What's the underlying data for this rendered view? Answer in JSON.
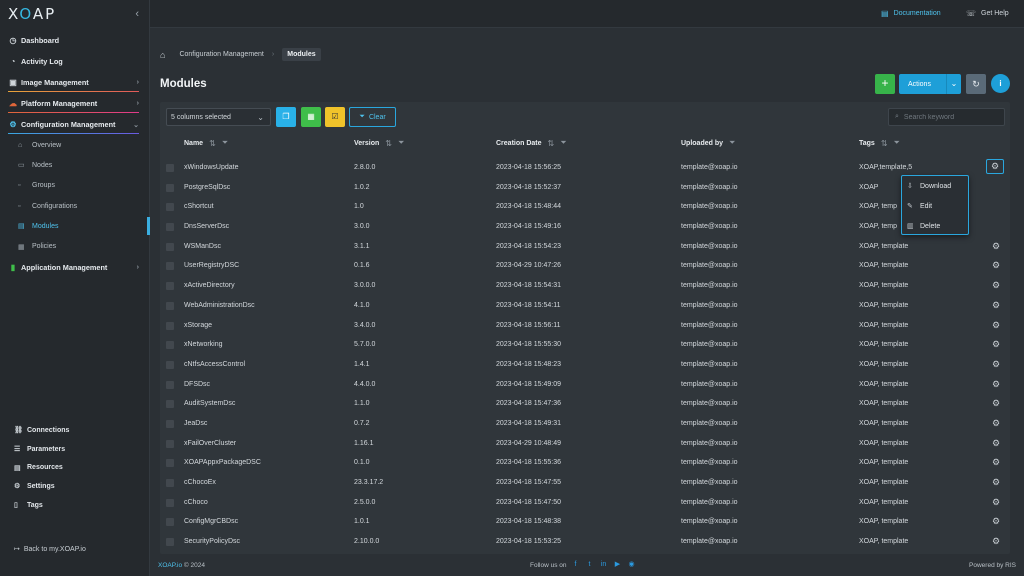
{
  "app": {
    "logo": "XOAP"
  },
  "topbar": {
    "documentation": "Documentation",
    "help": "Get Help"
  },
  "sidebar": {
    "items": [
      {
        "label": "Dashboard",
        "icon": "dashboard-icon"
      },
      {
        "label": "Activity Log",
        "icon": "clock-icon"
      },
      {
        "label": "Image Management",
        "icon": "image-icon"
      },
      {
        "label": "Platform Management",
        "icon": "cloud-icon"
      },
      {
        "label": "Configuration Management",
        "icon": "config-icon"
      },
      {
        "label": "Application Management",
        "icon": "apps-icon"
      }
    ],
    "sub_items": [
      "Overview",
      "Nodes",
      "Groups",
      "Configurations",
      "Modules",
      "Policies"
    ],
    "bottom_items": [
      "Connections",
      "Parameters",
      "Resources",
      "Settings",
      "Tags"
    ],
    "back": "Back to my.XOAP.io"
  },
  "breadcrumb": {
    "parent": "Configuration Management",
    "current": "Modules"
  },
  "page": {
    "title": "Modules",
    "actions_label": "Actions"
  },
  "toolbar": {
    "columns_selected": "5 columns selected",
    "clear_label": "Clear",
    "search_placeholder": "Search keyword"
  },
  "table": {
    "headers": [
      "Name",
      "Version",
      "Creation Date",
      "Uploaded by",
      "Tags"
    ],
    "rows": [
      [
        "xWindowsUpdate",
        "2.8.0.0",
        "2023-04-18 15:56:25",
        "template@xoap.io",
        "XOAP,template,5"
      ],
      [
        "PostgreSqlDsc",
        "1.0.2",
        "2023-04-18 15:52:37",
        "template@xoap.io",
        "XOAP"
      ],
      [
        "cShortcut",
        "1.0",
        "2023-04-18 15:48:44",
        "template@xoap.io",
        "XOAP, temp"
      ],
      [
        "DnsServerDsc",
        "3.0.0",
        "2023-04-18 15:49:16",
        "template@xoap.io",
        "XOAP, temp"
      ],
      [
        "WSManDsc",
        "3.1.1",
        "2023-04-18 15:54:23",
        "template@xoap.io",
        "XOAP, template"
      ],
      [
        "UserRegistryDSC",
        "0.1.6",
        "2023-04-29 10:47:26",
        "template@xoap.io",
        "XOAP, template"
      ],
      [
        "xActiveDirectory",
        "3.0.0.0",
        "2023-04-18 15:54:31",
        "template@xoap.io",
        "XOAP, template"
      ],
      [
        "WebAdministrationDsc",
        "4.1.0",
        "2023-04-18 15:54:11",
        "template@xoap.io",
        "XOAP, template"
      ],
      [
        "xStorage",
        "3.4.0.0",
        "2023-04-18 15:56:11",
        "template@xoap.io",
        "XOAP, template"
      ],
      [
        "xNetworking",
        "5.7.0.0",
        "2023-04-18 15:55:30",
        "template@xoap.io",
        "XOAP, template"
      ],
      [
        "cNtfsAccessControl",
        "1.4.1",
        "2023-04-18 15:48:23",
        "template@xoap.io",
        "XOAP, template"
      ],
      [
        "DFSDsc",
        "4.4.0.0",
        "2023-04-18 15:49:09",
        "template@xoap.io",
        "XOAP, template"
      ],
      [
        "AuditSystemDsc",
        "1.1.0",
        "2023-04-18 15:47:36",
        "template@xoap.io",
        "XOAP, template"
      ],
      [
        "JeaDsc",
        "0.7.2",
        "2023-04-18 15:49:31",
        "template@xoap.io",
        "XOAP, template"
      ],
      [
        "xFailOverCluster",
        "1.16.1",
        "2023-04-29 10:48:49",
        "template@xoap.io",
        "XOAP, template"
      ],
      [
        "XOAPAppxPackageDSC",
        "0.1.0",
        "2023-04-18 15:55:36",
        "template@xoap.io",
        "XOAP, template"
      ],
      [
        "cChocoEx",
        "23.3.17.2",
        "2023-04-18 15:47:55",
        "template@xoap.io",
        "XOAP, template"
      ],
      [
        "cChoco",
        "2.5.0.0",
        "2023-04-18 15:47:50",
        "template@xoap.io",
        "XOAP, template"
      ],
      [
        "ConfigMgrCBDsc",
        "1.0.1",
        "2023-04-18 15:48:38",
        "template@xoap.io",
        "XOAP, template"
      ],
      [
        "SecurityPolicyDsc",
        "2.10.0.0",
        "2023-04-18 15:53:25",
        "template@xoap.io",
        "XOAP, template"
      ]
    ]
  },
  "dropdown": {
    "items": [
      "Download",
      "Edit",
      "Delete"
    ]
  },
  "footer": {
    "brand": "XOAP.io",
    "copyright": "© 2024",
    "follow": "Follow us on",
    "powered": "Powered by RIS"
  },
  "colors": {
    "accent": "#1e9fd8",
    "add": "#37b34a",
    "excel": "#3fbe4a",
    "copy": "#29b1e8",
    "check": "#f0c32a"
  }
}
